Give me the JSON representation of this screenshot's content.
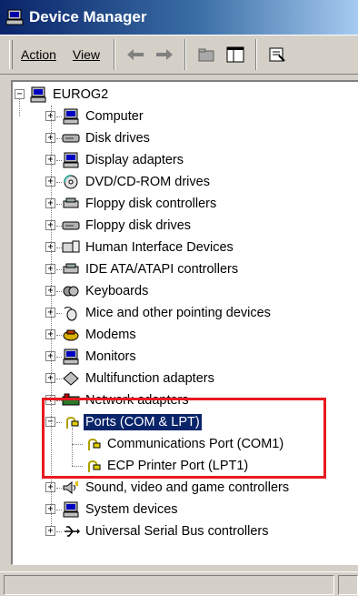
{
  "window": {
    "title": "Device Manager"
  },
  "menu": {
    "action": "Action",
    "view": "View"
  },
  "tree": {
    "root": "EUROG2",
    "categories": [
      "Computer",
      "Disk drives",
      "Display adapters",
      "DVD/CD-ROM drives",
      "Floppy disk controllers",
      "Floppy disk drives",
      "Human Interface Devices",
      "IDE ATA/ATAPI controllers",
      "Keyboards",
      "Mice and other pointing devices",
      "Modems",
      "Monitors",
      "Multifunction adapters",
      "Network adapters",
      "Ports (COM & LPT)",
      "Sound, video and game controllers",
      "System devices",
      "Universal Serial Bus controllers"
    ],
    "ports_children": [
      "Communications Port (COM1)",
      "ECP Printer Port (LPT1)"
    ],
    "expanded": "Ports (COM & LPT)",
    "selected": "Ports (COM & LPT)"
  },
  "colors": {
    "highlight_box": "#e8191f",
    "selection": "#0a246a",
    "title_bar": "#0a246a"
  },
  "icons": {
    "app": "device-manager-icon",
    "toolbar": [
      "back-arrow-icon",
      "forward-arrow-icon",
      "up-folder-icon",
      "show-hide-tree-icon",
      "properties-icon"
    ]
  }
}
